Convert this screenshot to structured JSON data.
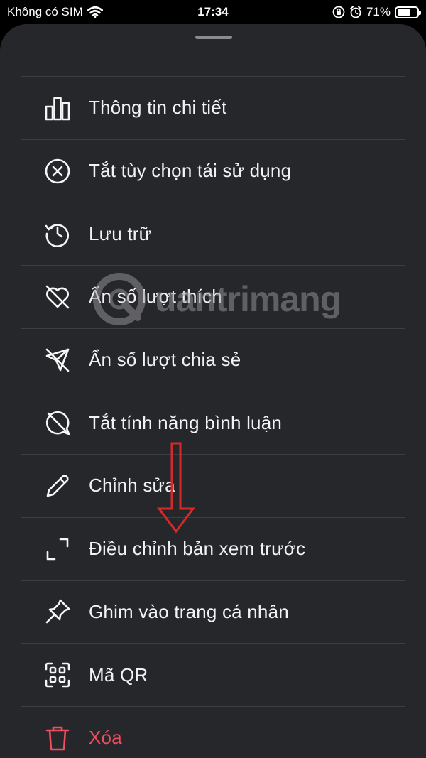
{
  "status_bar": {
    "carrier": "Không có SIM",
    "time": "17:34",
    "battery_percent_label": "71%",
    "battery_level": 0.71
  },
  "menu": {
    "items": [
      {
        "label": "Thông tin chi tiết",
        "icon": "bar-chart-icon"
      },
      {
        "label": "Tắt tùy chọn tái sử dụng",
        "icon": "circle-x-icon"
      },
      {
        "label": "Lưu trữ",
        "icon": "history-icon"
      },
      {
        "label": "Ẩn số lượt thích",
        "icon": "heart-off-icon"
      },
      {
        "label": "Ẩn số lượt chia sẻ",
        "icon": "send-off-icon"
      },
      {
        "label": "Tắt tính năng bình luận",
        "icon": "comment-off-icon"
      },
      {
        "label": "Chỉnh sửa",
        "icon": "pencil-icon"
      },
      {
        "label": "Điều chỉnh bản xem trước",
        "icon": "expand-icon"
      },
      {
        "label": "Ghim vào trang cá nhân",
        "icon": "pin-icon"
      },
      {
        "label": "Mã QR",
        "icon": "qr-code-icon"
      },
      {
        "label": "Xóa",
        "icon": "trash-icon"
      }
    ]
  },
  "watermark": {
    "text": "uantrimang"
  },
  "colors": {
    "sheet_bg": "#26272b",
    "divider": "#3d3e42",
    "text": "#f2f2f2",
    "danger": "#ef4e5c",
    "annotation_arrow": "#d42a2a"
  }
}
